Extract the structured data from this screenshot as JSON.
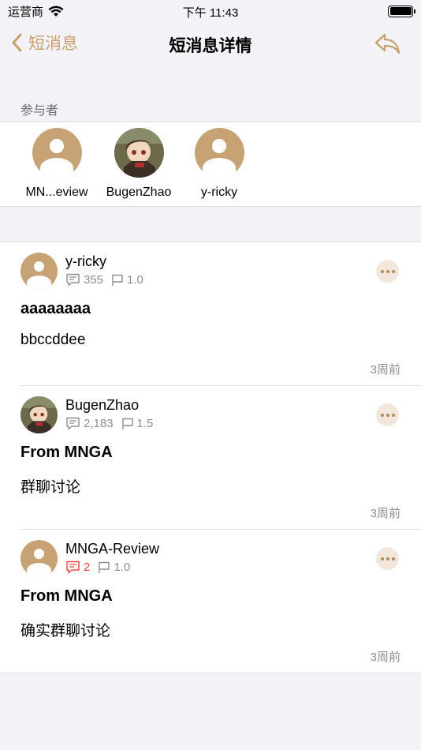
{
  "status_bar": {
    "carrier": "运营商",
    "time": "下午 11:43"
  },
  "nav": {
    "back_label": "短消息",
    "title": "短消息详情"
  },
  "participants_section": {
    "label": "参与者",
    "participants": [
      {
        "name": "MN...eview",
        "avatar": "default-avatar"
      },
      {
        "name": "BugenZhao",
        "avatar": "anime-avatar"
      },
      {
        "name": "y-ricky",
        "avatar": "default-avatar"
      }
    ]
  },
  "messages": [
    {
      "user": "y-ricky",
      "avatar": "default-avatar",
      "posts": "355",
      "rep": "1.0",
      "title": "aaaaaaaa",
      "body": "bbccddee",
      "time": "3周前"
    },
    {
      "user": "BugenZhao",
      "avatar": "anime-avatar",
      "posts": "2,183",
      "rep": "1.5",
      "title": "From MNGA",
      "body": "群聊讨论",
      "time": "3周前"
    },
    {
      "user": "MNGA-Review",
      "avatar": "default-avatar",
      "posts": "2",
      "posts_highlight": true,
      "rep": "1.0",
      "title": "From MNGA",
      "body": "确实群聊讨论",
      "time": "3周前"
    }
  ],
  "colors": {
    "accent": "#c9a06c",
    "background": "#f2f2f7",
    "highlight": "#e5453a"
  }
}
